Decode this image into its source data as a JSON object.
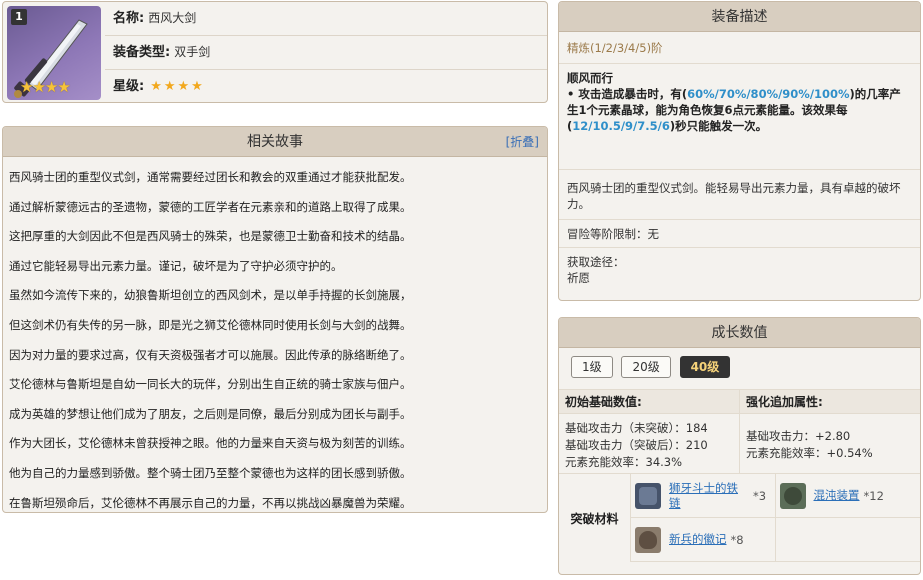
{
  "card": {
    "level_badge": "1",
    "thumb_stars": "★★★★",
    "name_label": "名称:",
    "name_value": "西风大剑",
    "type_label": "装备类型:",
    "type_value": "双手剑",
    "rarity_label": "星级:",
    "rarity_stars": "★★★★",
    "rarity_value": 4
  },
  "story": {
    "title": "相关故事",
    "toggle_label": "[折叠]",
    "lines": [
      "西风骑士团的重型仪式剑，通常需要经过团长和教会的双重通过才能获批配发。",
      "通过解析蒙德远古的圣遗物，蒙德的工匠学者在元素亲和的道路上取得了成果。",
      "这把厚重的大剑因此不但是西风骑士的殊荣，也是蒙德卫士勤奋和技术的结晶。",
      "通过它能轻易导出元素力量。谨记，破坏是为了守护必须守护的。",
      "虽然如今流传下来的，幼狼鲁斯坦创立的西风剑术，是以单手持握的长剑施展，",
      "但这剑术仍有失传的另一脉，即是光之狮艾伦德林同时使用长剑与大剑的战舞。",
      "因为对力量的要求过高，仅有天资极强者才可以施展。因此传承的脉络断绝了。",
      "艾伦德林与鲁斯坦是自幼一同长大的玩伴，分别出生自正统的骑士家族与佃户。",
      "成为英雄的梦想让他们成为了朋友，之后则是同僚，最后分别成为团长与副手。",
      "作为大团长，艾伦德林未曾获授神之眼。他的力量来自天资与极为刻苦的训练。",
      "他为自己的力量感到骄傲。整个骑士团乃至整个蒙德也为这样的团长感到骄傲。",
      "在鲁斯坦殒命后，艾伦德林不再展示自己的力量，不再以挑战凶暴魔兽为荣耀。"
    ]
  },
  "equip": {
    "title": "装备描述",
    "refine": "精炼(1/2/3/4/5)阶",
    "passive_name": "顺风而行",
    "passive_p1": "• 攻击造成暴击时，有(",
    "passive_h1": "60%/70%/80%/90%/100%",
    "passive_p2": ")的几率产生1个元素晶球，能为角色恢复6点元素能量。该效果每(",
    "passive_h2": "12/10.5/9/7.5/6",
    "passive_p3": ")秒只能触发一次。",
    "desc": "西风骑士团的重型仪式剑。能轻易导出元素力量，具有卓越的破坏力。",
    "rank_limit": "冒险等阶限制：无",
    "source_label": "获取途径：",
    "source_value": "祈愿"
  },
  "growth": {
    "title": "成长数值",
    "tabs": [
      "1级",
      "20级",
      "40级"
    ],
    "active_tab": "40级",
    "base_head": "初始基础数值:",
    "base_lines": [
      "基础攻击力（未突破）：184",
      "基础攻击力（突破后）：210",
      "元素充能效率：34.3%"
    ],
    "bonus_head": "强化追加属性:",
    "bonus_lines": [
      "基础攻击力：+2.80",
      "元素充能效率：+0.54%"
    ],
    "mat_label": "突破材料",
    "materials": [
      {
        "name": "狮牙斗士的铁链",
        "count": "*3",
        "icon": "iron-chain-icon"
      },
      {
        "name": "混沌装置",
        "count": "*12",
        "icon": "chaos-device-icon"
      },
      {
        "name": "新兵的徽记",
        "count": "*8",
        "icon": "recruit-insignia-icon"
      }
    ]
  },
  "colors": {
    "header_bg": "#d8cec0",
    "highlight": "#2f8fc9",
    "link": "#2b6fb8",
    "active_tab_bg": "#333333",
    "active_tab_text": "#f6d37a",
    "star": "#f2a81d"
  }
}
